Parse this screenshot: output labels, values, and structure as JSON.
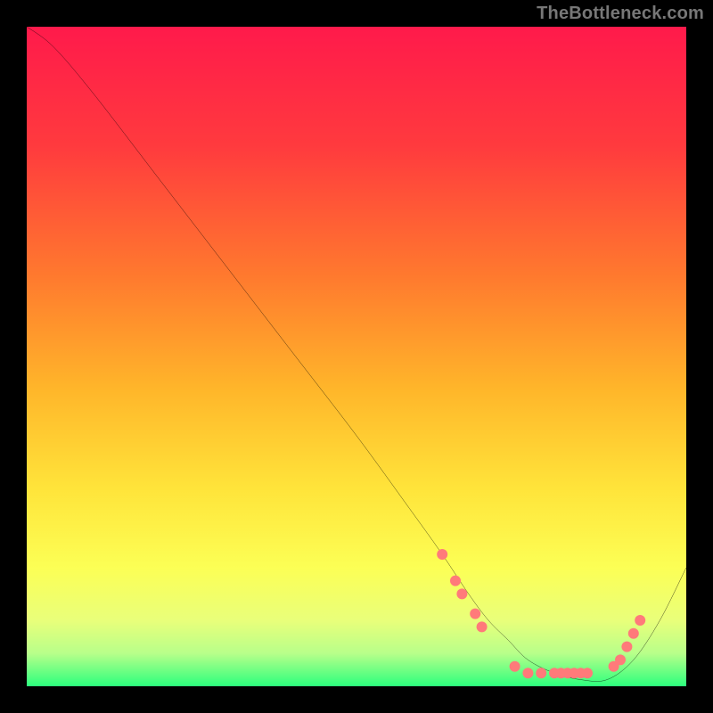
{
  "watermark": "TheBottleneck.com",
  "chart_data": {
    "type": "line",
    "title": "",
    "xlabel": "",
    "ylabel": "",
    "xlim": [
      0,
      100
    ],
    "ylim": [
      0,
      100
    ],
    "background_gradient": {
      "stops": [
        {
          "offset": 0,
          "color": "#ff1a4b"
        },
        {
          "offset": 18,
          "color": "#ff3a3e"
        },
        {
          "offset": 38,
          "color": "#ff7a2e"
        },
        {
          "offset": 55,
          "color": "#ffb62a"
        },
        {
          "offset": 70,
          "color": "#ffe43a"
        },
        {
          "offset": 82,
          "color": "#fcff55"
        },
        {
          "offset": 90,
          "color": "#e9ff7a"
        },
        {
          "offset": 95,
          "color": "#b8ff8a"
        },
        {
          "offset": 100,
          "color": "#2cff7d"
        }
      ]
    },
    "series": [
      {
        "name": "bottleneck-curve",
        "color": "#000000",
        "x": [
          0,
          4,
          10,
          20,
          30,
          40,
          50,
          58,
          63,
          67,
          70,
          73,
          76,
          80,
          84,
          88,
          92,
          96,
          100
        ],
        "y": [
          100,
          97,
          90,
          77,
          64,
          51,
          38,
          27,
          20,
          14,
          10,
          7,
          4,
          2,
          1,
          1,
          4,
          10,
          18
        ]
      }
    ],
    "markers": {
      "name": "highlight-dots",
      "color": "#ff7a7a",
      "radius": 6,
      "points": [
        {
          "x": 63,
          "y": 20
        },
        {
          "x": 65,
          "y": 16
        },
        {
          "x": 66,
          "y": 14
        },
        {
          "x": 68,
          "y": 11
        },
        {
          "x": 69,
          "y": 9
        },
        {
          "x": 74,
          "y": 3
        },
        {
          "x": 76,
          "y": 2
        },
        {
          "x": 78,
          "y": 2
        },
        {
          "x": 80,
          "y": 2
        },
        {
          "x": 81,
          "y": 2
        },
        {
          "x": 82,
          "y": 2
        },
        {
          "x": 83,
          "y": 2
        },
        {
          "x": 84,
          "y": 2
        },
        {
          "x": 85,
          "y": 2
        },
        {
          "x": 89,
          "y": 3
        },
        {
          "x": 90,
          "y": 4
        },
        {
          "x": 91,
          "y": 6
        },
        {
          "x": 92,
          "y": 8
        },
        {
          "x": 93,
          "y": 10
        }
      ]
    }
  }
}
